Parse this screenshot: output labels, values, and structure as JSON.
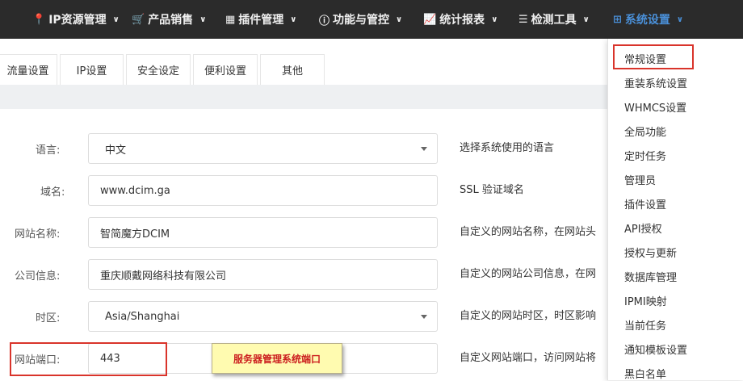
{
  "nav": {
    "items": [
      {
        "icon": "map-marker-icon",
        "label": "IP资源管理"
      },
      {
        "icon": "cart-icon",
        "label": "产品销售"
      },
      {
        "icon": "grid-icon",
        "label": "插件管理"
      },
      {
        "icon": "info-circle-icon",
        "label": "功能与管控"
      },
      {
        "icon": "line-chart-icon",
        "label": "统计报表"
      },
      {
        "icon": "list-icon",
        "label": "检测工具"
      },
      {
        "icon": "windows-icon",
        "label": "系统设置"
      }
    ]
  },
  "tabs": [
    "流量设置",
    "IP设置",
    "安全设定",
    "便利设置",
    "其他"
  ],
  "form": {
    "rows": [
      {
        "label": "语言:",
        "value": "中文",
        "help": "选择系统使用的语言"
      },
      {
        "label": "域名:",
        "value": "www.dcim.ga",
        "help": "SSL 验证域名"
      },
      {
        "label": "网站名称:",
        "value": "智简魔方DCIM",
        "help": "自定义的网站名称，在网站头"
      },
      {
        "label": "公司信息:",
        "value": "重庆顺戴网络科技有限公司",
        "help": "自定义的网站公司信息，在网"
      },
      {
        "label": "时区:",
        "value": "Asia/Shanghai",
        "help": "自定义的网站时区，时区影响"
      },
      {
        "label": "网站端口:",
        "value": "443",
        "help": "自定义网站端口，访问网站将"
      }
    ]
  },
  "annotation": {
    "callout_text": "服务器管理系统端口",
    "highlight_color": "#d9342b"
  },
  "menu": {
    "items": [
      "常规设置",
      "重装系统设置",
      "WHMCS设置",
      "全局功能",
      "定时任务",
      "管理员",
      "插件设置",
      "API授权",
      "授权与更新",
      "数据库管理",
      "IPMI映射",
      "当前任务",
      "通知模板设置",
      "黑白名单"
    ]
  },
  "colors": {
    "nav_bg": "#2b2b2b",
    "accent": "#4a90d9"
  }
}
